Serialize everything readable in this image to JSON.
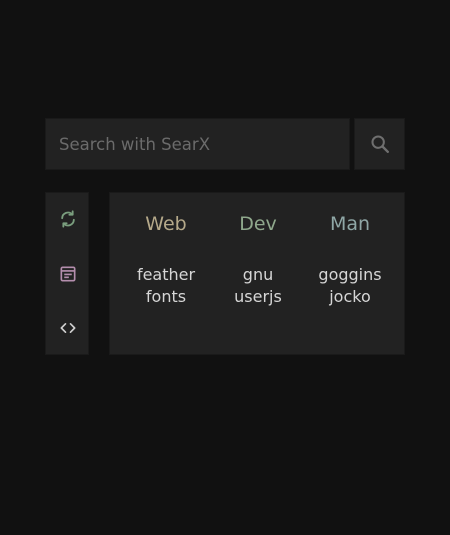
{
  "search": {
    "placeholder": "Search with SearX",
    "value": "",
    "button_icon": "search-icon"
  },
  "sidebar": {
    "buttons": [
      {
        "icon": "refresh-icon",
        "color": "#7a9e7e"
      },
      {
        "icon": "article-icon",
        "color": "#b48ead"
      },
      {
        "icon": "code-icon",
        "color": "#d0d0d0"
      }
    ]
  },
  "link_groups": [
    {
      "title": "Web",
      "color": "#b5a98a",
      "links": [
        "feather",
        "fonts"
      ]
    },
    {
      "title": "Dev",
      "color": "#8fa88c",
      "links": [
        "gnu",
        "userjs"
      ]
    },
    {
      "title": "Man",
      "color": "#8fa7a6",
      "links": [
        "goggins",
        "jocko"
      ]
    }
  ],
  "colors": {
    "background": "#111111",
    "panel": "#222222",
    "link_text": "#d6d6d6",
    "placeholder": "#6b6b6b"
  }
}
